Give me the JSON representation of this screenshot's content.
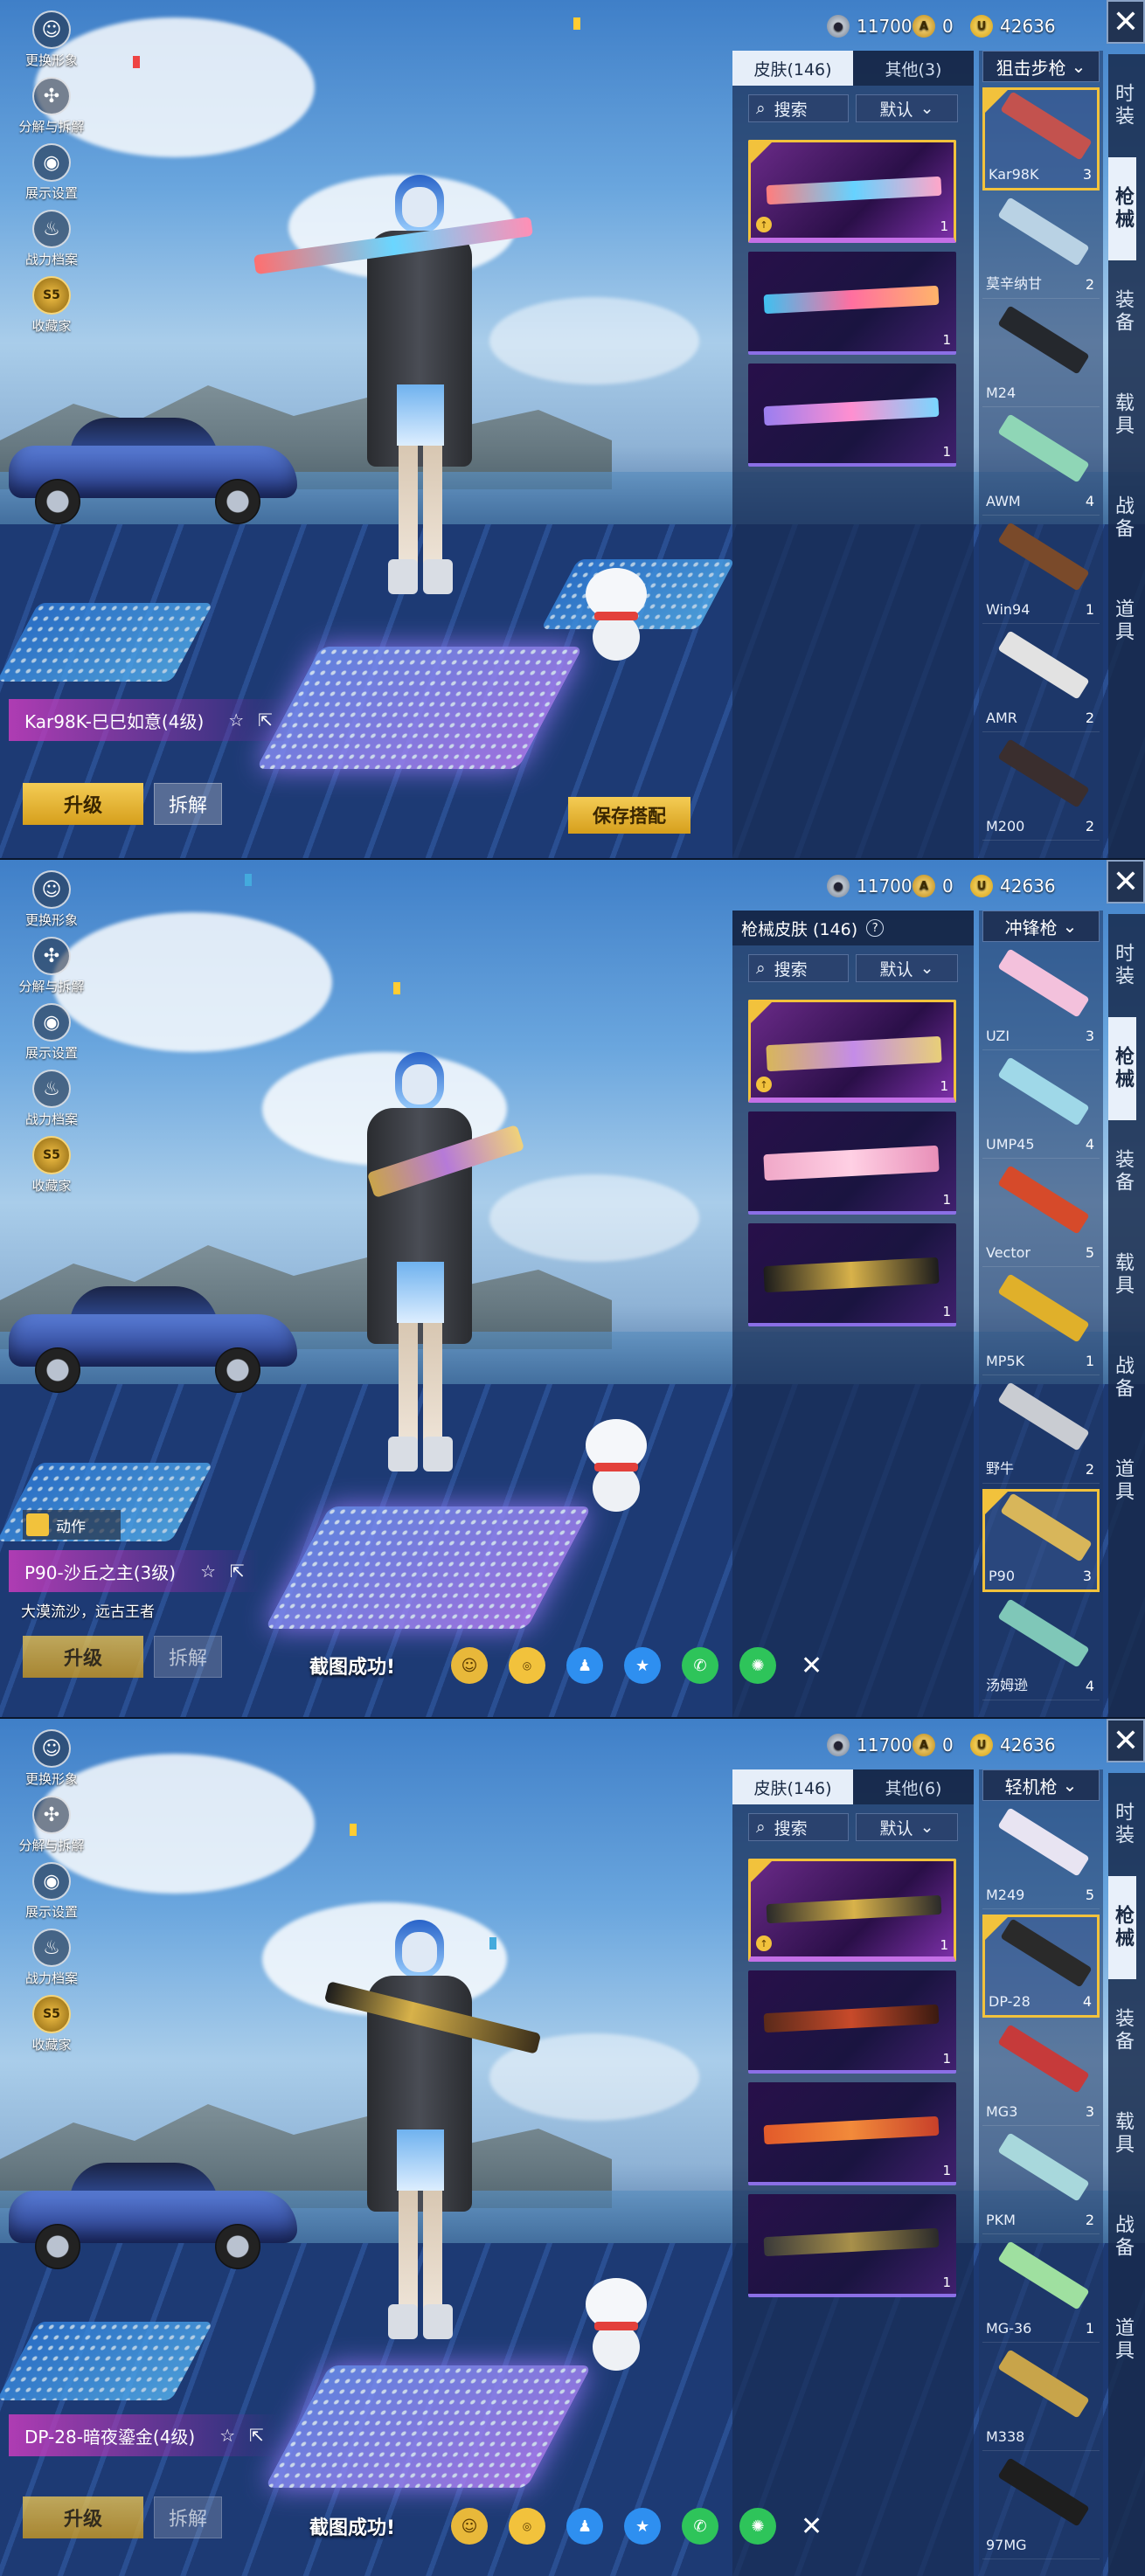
{
  "currency": {
    "silver": "11700",
    "ag": "0",
    "uc": "42636"
  },
  "left_menu": [
    "更换形象",
    "分解与拆解",
    "展示设置",
    "战力档案",
    "收藏家"
  ],
  "right_tabs": [
    "时装",
    "枪械",
    "装备",
    "载具",
    "战备",
    "道具"
  ],
  "screens": [
    {
      "skin_tab_a": "皮肤(146)",
      "skin_tab_b": "其他(3)",
      "search": "搜索",
      "sort": "默认",
      "category": "狙击步枪",
      "weapons": [
        {
          "name": "Kar98K",
          "count": "3"
        },
        {
          "name": "莫辛纳甘",
          "count": "2"
        },
        {
          "name": "M24",
          "count": ""
        },
        {
          "name": "AWM",
          "count": "4"
        },
        {
          "name": "Win94",
          "count": "1"
        },
        {
          "name": "AMR",
          "count": "2"
        },
        {
          "name": "M200",
          "count": "2"
        }
      ],
      "skin_counts": [
        "1",
        "1",
        "1"
      ],
      "weapon_name": "Kar98K-巳巳如意(4级)",
      "upgrade": "升级",
      "dismantle": "拆解",
      "save": "保存搭配"
    },
    {
      "skin_title": "枪械皮肤 (146)",
      "search": "搜索",
      "sort": "默认",
      "category": "冲锋枪",
      "weapons": [
        {
          "name": "UZI",
          "count": "3"
        },
        {
          "name": "UMP45",
          "count": "4"
        },
        {
          "name": "Vector",
          "count": "5"
        },
        {
          "name": "MP5K",
          "count": "1"
        },
        {
          "name": "野牛",
          "count": "2"
        },
        {
          "name": "P90",
          "count": "3"
        },
        {
          "name": "汤姆逊",
          "count": "4"
        }
      ],
      "skin_counts": [
        "1",
        "1",
        "1"
      ],
      "motion": "动作",
      "weapon_name": "P90-沙丘之主(3级)",
      "subtitle": "大漠流沙，远古王者",
      "upgrade": "升级",
      "dismantle": "拆解",
      "share_msg": "截图成功!"
    },
    {
      "skin_tab_a": "皮肤(146)",
      "skin_tab_b": "其他(6)",
      "search": "搜索",
      "sort": "默认",
      "category": "轻机枪",
      "weapons": [
        {
          "name": "M249",
          "count": "5"
        },
        {
          "name": "DP-28",
          "count": "4"
        },
        {
          "name": "MG3",
          "count": "3"
        },
        {
          "name": "PKM",
          "count": "2"
        },
        {
          "name": "MG-36",
          "count": "1"
        },
        {
          "name": "M338",
          "count": ""
        },
        {
          "name": "97MG",
          "count": ""
        }
      ],
      "skin_counts": [
        "1",
        "1",
        "1",
        "1"
      ],
      "weapon_name": "DP-28-暗夜鎏金(4级)",
      "upgrade": "升级",
      "dismantle": "拆解",
      "share_msg": "截图成功!"
    }
  ],
  "colors": {
    "accent_gold": "#f2c23c",
    "panel": "#182c54",
    "highlight": "#c46fe6"
  }
}
